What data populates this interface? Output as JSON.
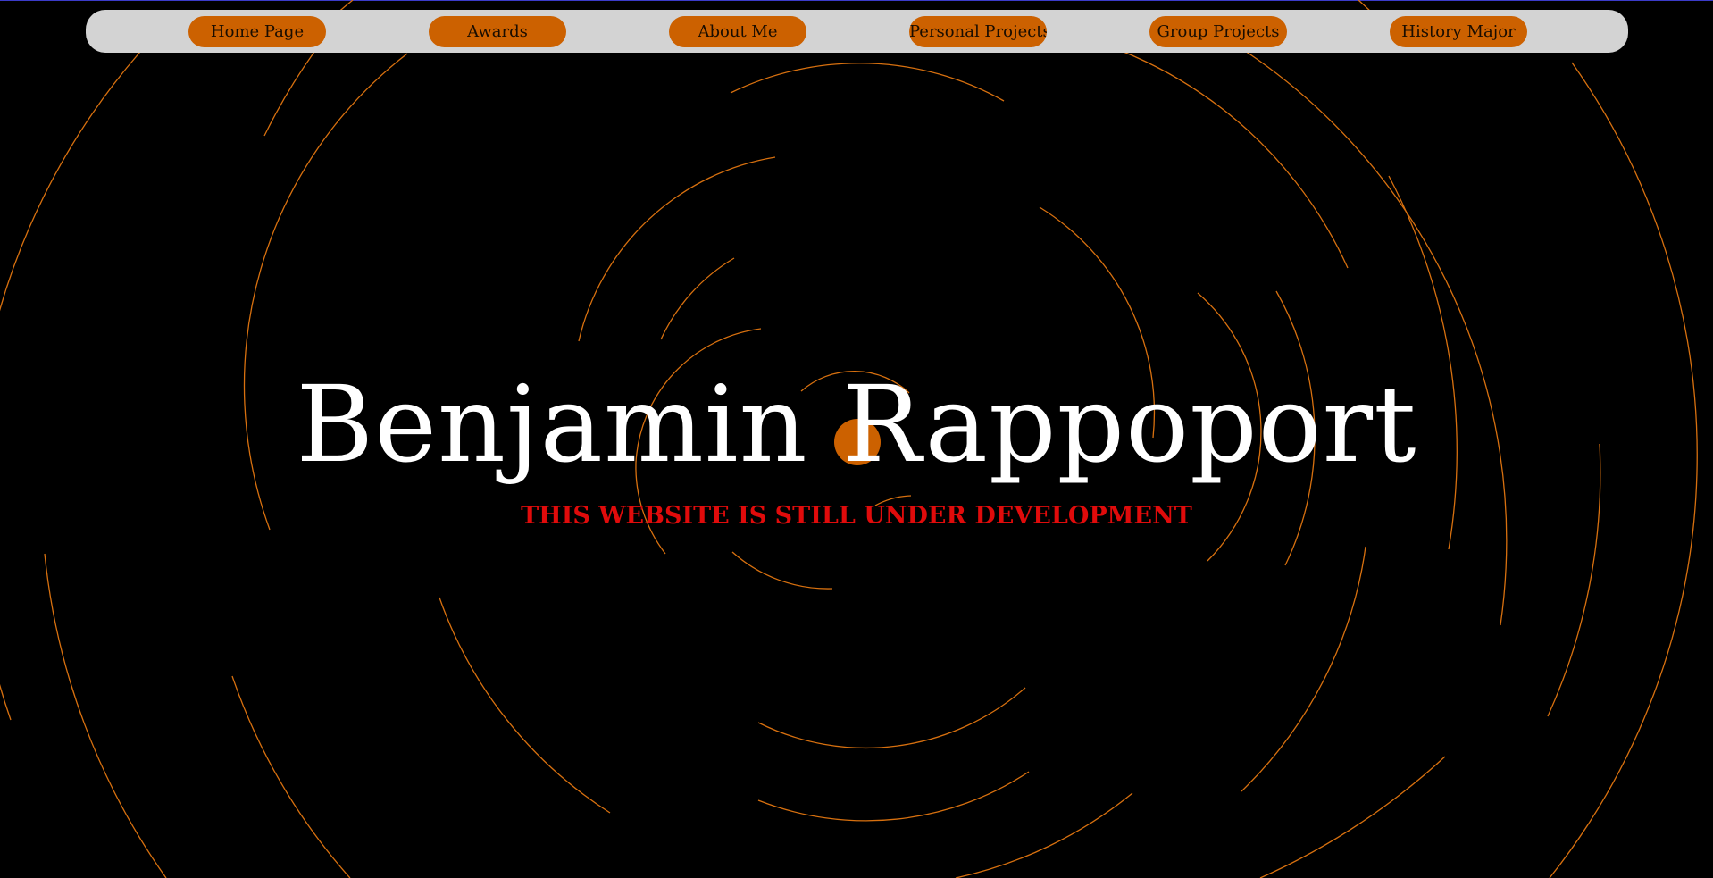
{
  "nav": {
    "items": [
      {
        "label": "Home Page"
      },
      {
        "label": "Awards"
      },
      {
        "label": "About Me"
      },
      {
        "label": "Personal Projects"
      },
      {
        "label": "Group Projects"
      },
      {
        "label": "History Major"
      }
    ]
  },
  "hero": {
    "name": "Benjamin Rappoport",
    "notice": "THIS WEBSITE IS STILL UNDER DEVELOPMENT"
  },
  "colors": {
    "background": "#000000",
    "nav_bar": "#d3d3d3",
    "accent_orange": "#cc6100",
    "arc_stroke": "#d7700f",
    "headline": "#ffffff",
    "notice_red": "#e00b0b"
  }
}
